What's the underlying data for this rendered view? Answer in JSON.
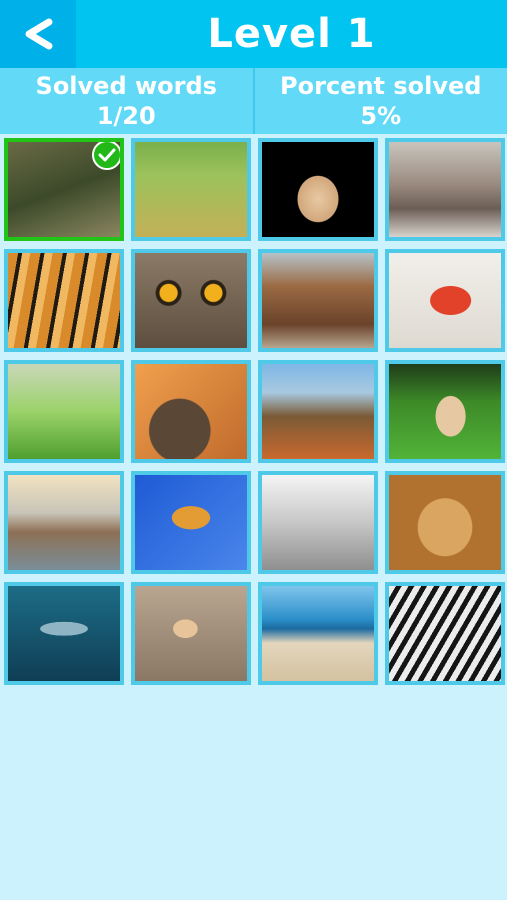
{
  "header": {
    "back_icon": "chevron-left-icon",
    "title": "Level 1"
  },
  "stats": {
    "solved_label": "Solved words",
    "solved_value": "1/20",
    "percent_label": "Porcent solved",
    "percent_value": "5%"
  },
  "tiles": [
    {
      "subject": "butterfly",
      "solved": true
    },
    {
      "subject": "sheep",
      "solved": false
    },
    {
      "subject": "rabbit",
      "solved": false
    },
    {
      "subject": "elephant",
      "solved": false
    },
    {
      "subject": "tiger",
      "solved": false
    },
    {
      "subject": "owl",
      "solved": false
    },
    {
      "subject": "horse",
      "solved": false
    },
    {
      "subject": "starfish",
      "solved": false
    },
    {
      "subject": "squirrel",
      "solved": false
    },
    {
      "subject": "duck",
      "solved": false
    },
    {
      "subject": "turtle",
      "solved": false
    },
    {
      "subject": "monkey",
      "solved": false
    },
    {
      "subject": "crocodile",
      "solved": false
    },
    {
      "subject": "bee",
      "solved": false
    },
    {
      "subject": "cat",
      "solved": false
    },
    {
      "subject": "lion",
      "solved": false
    },
    {
      "subject": "shark",
      "solved": false
    },
    {
      "subject": "snail",
      "solved": false
    },
    {
      "subject": "kangaroo",
      "solved": false
    },
    {
      "subject": "zebra",
      "solved": false
    }
  ],
  "colors": {
    "header": "#01c4f1",
    "stats_bar": "#62daf7",
    "background": "#cbf2fd",
    "tile_border": "#4ec9e8",
    "solved_border": "#22c418"
  }
}
